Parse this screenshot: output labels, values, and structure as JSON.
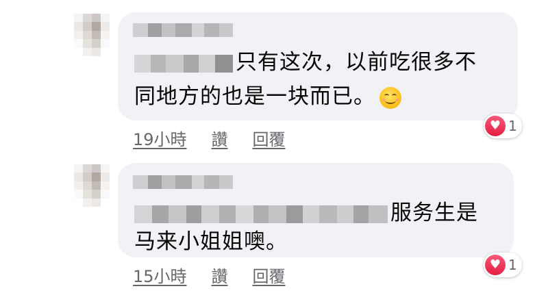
{
  "colors": {
    "bubble": "#f0f2f5",
    "meta_text": "#65676b",
    "love": "#e41e3f"
  },
  "comments": [
    {
      "text_line1": "只有这次，以前吃很多不",
      "text_line2": "同地方的也是一块而已。",
      "emoji": "smiling-face-icon",
      "time": "19小時",
      "like_label": "讚",
      "reply_label": "回覆",
      "reaction_icon": "heart-icon",
      "reaction_count": "1"
    },
    {
      "text_line1": "服务生是",
      "text_line2": "马来小姐姐噢。",
      "time": "15小時",
      "like_label": "讚",
      "reply_label": "回覆",
      "reaction_icon": "heart-icon",
      "reaction_count": "1"
    }
  ]
}
